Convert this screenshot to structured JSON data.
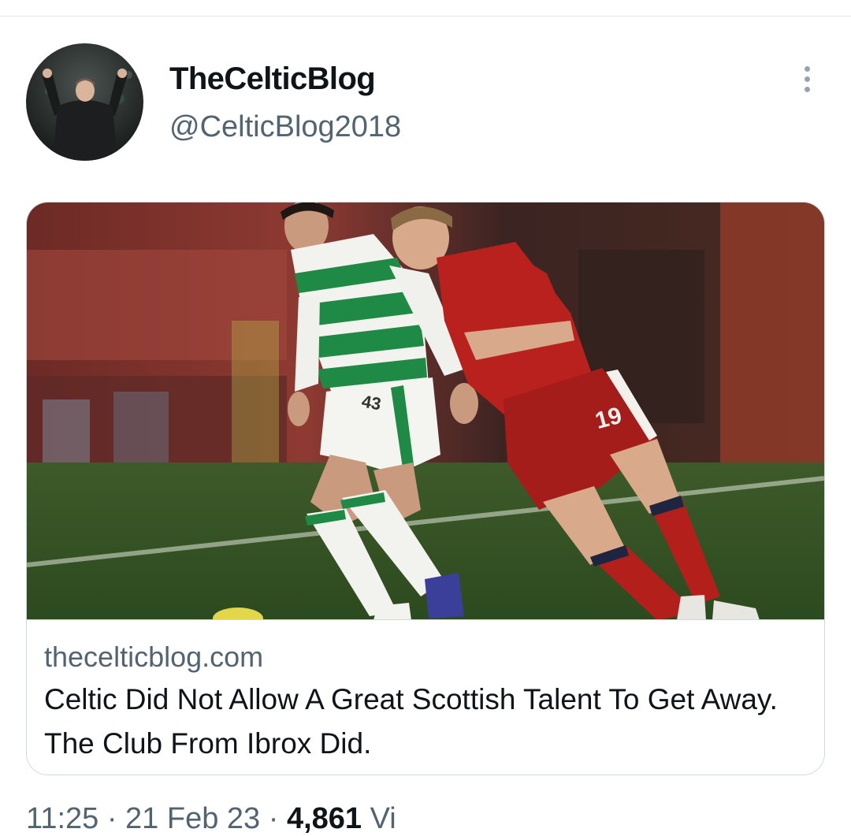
{
  "tweet": {
    "display_name": "TheCelticBlog",
    "handle": "@CelticBlog2018",
    "more_icon": "more-vertical-icon"
  },
  "card": {
    "domain": "thecelticblog.com",
    "title": "Celtic Did Not Allow A Great Scottish Talent To Get Away. The Club From Ibrox Did.",
    "image_shirt_number_right": "19",
    "image_shirt_number_left": "43"
  },
  "meta": {
    "time_date": "11:25 · 21 Feb 23 · ",
    "views_count": "4,861",
    "views_label": " Vi"
  }
}
